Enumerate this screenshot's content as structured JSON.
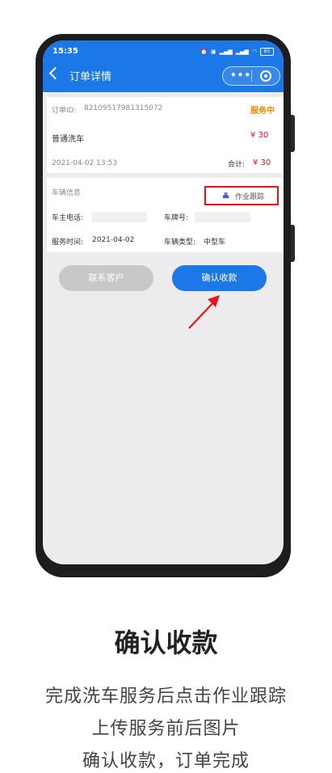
{
  "status": {
    "time": "15:35",
    "battery": "85"
  },
  "nav": {
    "title": "订单详情"
  },
  "order": {
    "id_label": "订单ID:",
    "id_value": "82109517981315072",
    "status": "服务中",
    "service_name": "普通洗车",
    "service_price": "¥ 30",
    "datetime": "2021-04-02 13:53",
    "total_label": "合计:",
    "total_value": "¥ 30"
  },
  "vehicle": {
    "section_title": "车辆信息",
    "track_label": "作业跟踪",
    "owner_phone_label": "车主电话:",
    "plate_label": "车牌号:",
    "service_time_label": "服务时间:",
    "service_time_value": "2021-04-02",
    "vehicle_type_label": "车辆类型:",
    "vehicle_type_value": "中型车"
  },
  "buttons": {
    "contact": "联系客户",
    "confirm": "确认收款"
  },
  "caption": {
    "title": "确认收款",
    "line1": "完成洗车服务后点击作业跟踪",
    "line2": "上传服务前后图片",
    "line3": "确认收款，订单完成"
  },
  "colors": {
    "primary": "#1b78e6",
    "price_red": "#d9141c",
    "status_orange": "#f08a00",
    "highlight_red": "#e2151b"
  }
}
